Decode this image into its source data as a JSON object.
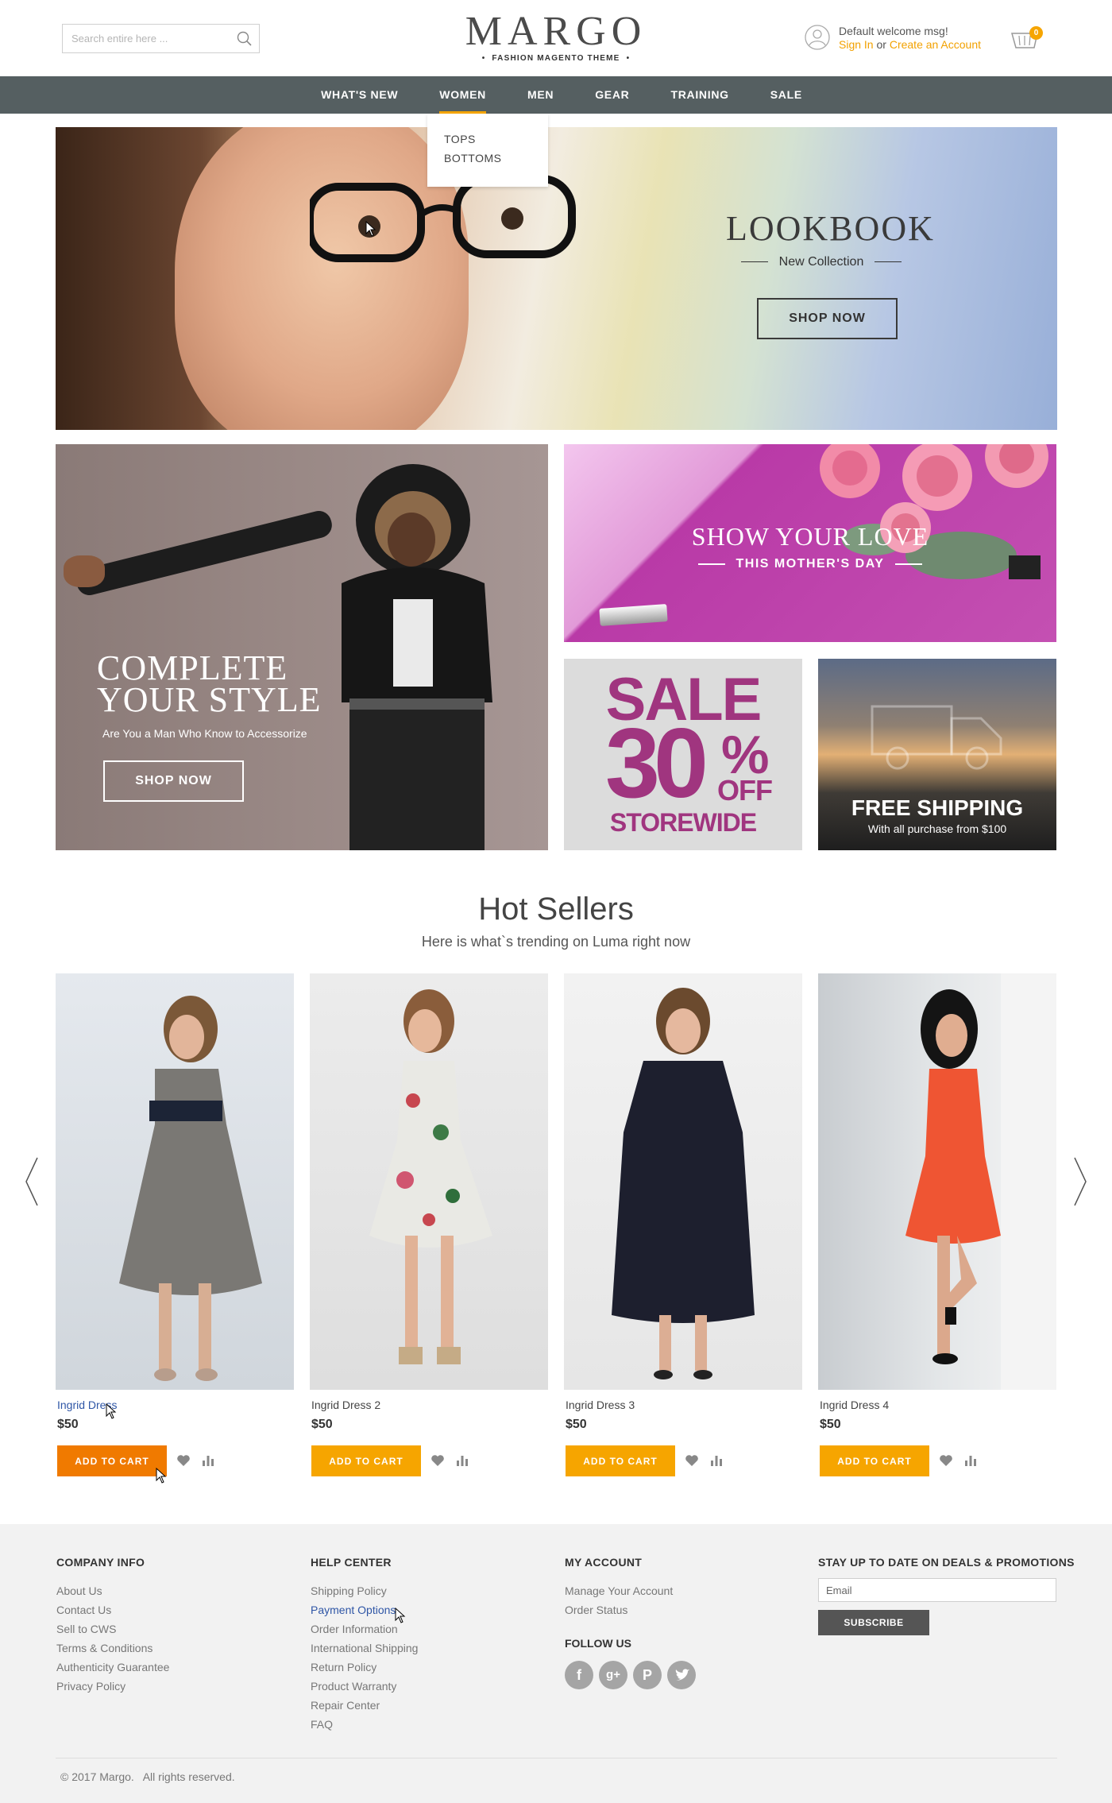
{
  "header": {
    "search_placeholder": "Search entire here ...",
    "logo": "MARGO",
    "logo_tagline": "FASHION MAGENTO THEME",
    "welcome": "Default welcome msg!",
    "sign_in": "Sign In",
    "or": " or ",
    "create_account": "Create an Account",
    "cart_count": "0"
  },
  "nav": {
    "items": [
      "WHAT'S NEW",
      "WOMEN",
      "MEN",
      "GEAR",
      "TRAINING",
      "SALE"
    ],
    "active": "WOMEN",
    "dropdown": [
      "TOPS",
      "BOTTOMS"
    ]
  },
  "hero": {
    "title": "LOOKBOOK",
    "subtitle": "New Collection",
    "button": "SHOP NOW"
  },
  "promos": {
    "style": {
      "title_line1": "COMPLETE",
      "title_line2": "YOUR STYLE",
      "subtitle": "Are You a Man Who Know to Accessorize",
      "button": "SHOP NOW"
    },
    "love": {
      "title": "SHOW YOUR LOVE",
      "subtitle": "THIS MOTHER'S DAY"
    },
    "sale": {
      "word": "SALE",
      "number": "30",
      "symbol": "%",
      "off": "OFF",
      "bottom": "STOREWIDE"
    },
    "shipping": {
      "title": "FREE SHIPPING",
      "subtitle": "With all purchase from $100"
    }
  },
  "hot_sellers": {
    "title": "Hot Sellers",
    "subtitle": "Here is what`s trending on Luma right now",
    "add_to_cart": "ADD TO CART",
    "products": [
      {
        "name": "Ingrid Dress",
        "price": "$50",
        "dress_color": "#7a7874"
      },
      {
        "name": "Ingrid Dress 2",
        "price": "$50",
        "dress_color": "#e9e9e4"
      },
      {
        "name": "Ingrid Dress 3",
        "price": "$50",
        "dress_color": "#1d1f2e"
      },
      {
        "name": "Ingrid Dress 4",
        "price": "$50",
        "dress_color": "#ef5533"
      }
    ]
  },
  "footer": {
    "company": {
      "title": "COMPANY INFO",
      "links": [
        "About Us",
        "Contact Us",
        "Sell to CWS",
        "Terms & Conditions",
        "Authenticity Guarantee",
        "Privacy Policy"
      ]
    },
    "help": {
      "title": "HELP CENTER",
      "links": [
        "Shipping Policy",
        "Payment Options",
        "Order Information",
        "International Shipping",
        "Return Policy",
        "Product Warranty",
        "Repair Center",
        "FAQ"
      ]
    },
    "account": {
      "title": "MY ACCOUNT",
      "links": [
        "Manage Your Account",
        "Order Status"
      ],
      "follow_title": "FOLLOW US",
      "socials": [
        "facebook-icon",
        "google-plus-icon",
        "pinterest-icon",
        "twitter-icon"
      ]
    },
    "newsletter": {
      "title": "STAY UP TO DATE ON DEALS & PROMOTIONS",
      "email_placeholder": "Email",
      "button": "SUBSCRIBE"
    },
    "copyright": "© 2017 Margo.   All rights reserved."
  },
  "colors": {
    "accent": "#f6a500",
    "nav_bg": "#555f61",
    "sale_purple": "#a0357f",
    "link_blue": "#2f56a6"
  }
}
